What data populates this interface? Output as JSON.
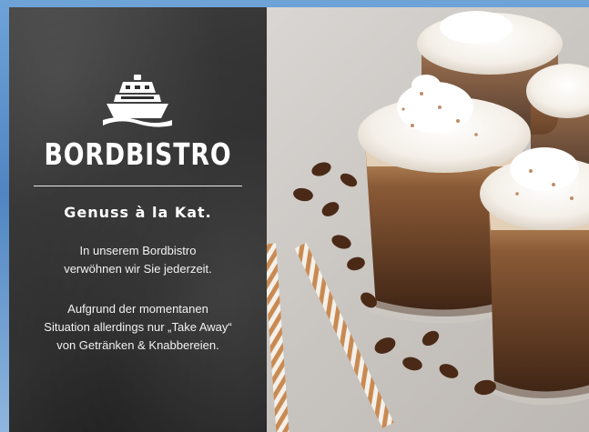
{
  "promo": {
    "logo_icon": "ship-icon",
    "title": "BORDBISTRO",
    "subtitle": "Genuss à la Kat.",
    "paragraph1": [
      "In unserem Bordbistro",
      "verwöhnen wir Sie jederzeit."
    ],
    "paragraph2": [
      "Aufgrund der momentanen",
      "Situation allerdings nur „Take Away“",
      "von Getränken & Knabbereien."
    ]
  },
  "image": {
    "subject": "coffee-drinks-photo"
  },
  "colors": {
    "panel": "#333333",
    "text": "#ffffff",
    "sky": "#5b8fc9"
  }
}
